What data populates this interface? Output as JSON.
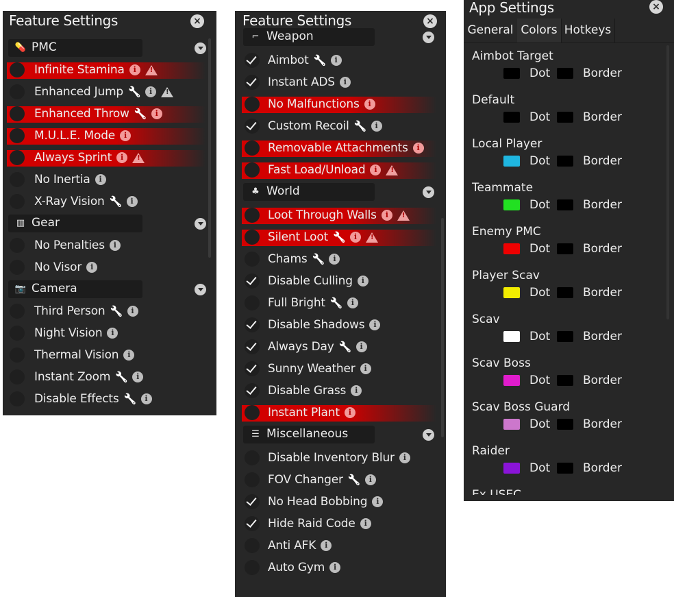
{
  "panel1": {
    "title": "Feature Settings",
    "close": "×",
    "sections": [
      {
        "name": "PMC",
        "icon": "pill-icon",
        "items": [
          {
            "label": "Infinite Stamina",
            "checked": false,
            "red": true,
            "wrench": false,
            "info": true,
            "warn": true
          },
          {
            "label": "Enhanced Jump",
            "checked": false,
            "red": false,
            "wrench": true,
            "info": true,
            "warn": true
          },
          {
            "label": "Enhanced Throw",
            "checked": false,
            "red": true,
            "wrench": true,
            "info": true,
            "warn": false
          },
          {
            "label": "M.U.L.E. Mode",
            "checked": false,
            "red": true,
            "wrench": false,
            "info": true,
            "warn": false
          },
          {
            "label": "Always Sprint",
            "checked": false,
            "red": true,
            "wrench": false,
            "info": true,
            "warn": true
          },
          {
            "label": "No Inertia",
            "checked": false,
            "red": false,
            "wrench": false,
            "info": true,
            "warn": false
          },
          {
            "label": "X-Ray Vision",
            "checked": false,
            "red": false,
            "wrench": true,
            "info": true,
            "warn": false
          }
        ]
      },
      {
        "name": "Gear",
        "icon": "gear-rack-icon",
        "items": [
          {
            "label": "No Penalties",
            "checked": false,
            "red": false,
            "wrench": false,
            "info": true,
            "warn": false
          },
          {
            "label": "No Visor",
            "checked": false,
            "red": false,
            "wrench": false,
            "info": true,
            "warn": false
          }
        ]
      },
      {
        "name": "Camera",
        "icon": "camera-icon",
        "items": [
          {
            "label": "Third Person",
            "checked": false,
            "red": false,
            "wrench": true,
            "info": true,
            "warn": false
          },
          {
            "label": "Night Vision",
            "checked": false,
            "red": false,
            "wrench": false,
            "info": true,
            "warn": false
          },
          {
            "label": "Thermal Vision",
            "checked": false,
            "red": false,
            "wrench": false,
            "info": true,
            "warn": false
          },
          {
            "label": "Instant Zoom",
            "checked": false,
            "red": false,
            "wrench": true,
            "info": true,
            "warn": false
          },
          {
            "label": "Disable Effects",
            "checked": false,
            "red": false,
            "wrench": true,
            "info": true,
            "warn": false
          }
        ]
      }
    ]
  },
  "panel2": {
    "title": "Feature Settings",
    "close": "×",
    "sections": [
      {
        "name": "Weapon",
        "icon": "pistol-icon",
        "items": [
          {
            "label": "Aimbot",
            "checked": true,
            "red": false,
            "wrench": true,
            "info": true,
            "warn": false
          },
          {
            "label": "Instant ADS",
            "checked": true,
            "red": false,
            "wrench": false,
            "info": true,
            "warn": false
          },
          {
            "label": "No Malfunctions",
            "checked": false,
            "red": true,
            "wrench": false,
            "info": true,
            "warn": false
          },
          {
            "label": "Custom Recoil",
            "checked": true,
            "red": false,
            "wrench": true,
            "info": true,
            "warn": false
          },
          {
            "label": "Removable Attachments",
            "checked": false,
            "red": true,
            "wrench": false,
            "info": true,
            "warn": false
          },
          {
            "label": "Fast Load/Unload",
            "checked": false,
            "red": true,
            "wrench": false,
            "info": true,
            "warn": true
          }
        ]
      },
      {
        "name": "World",
        "icon": "palm-tree-icon",
        "items": [
          {
            "label": "Loot Through Walls",
            "checked": false,
            "red": true,
            "wrench": false,
            "info": true,
            "warn": true
          },
          {
            "label": "Silent Loot",
            "checked": false,
            "red": true,
            "wrench": true,
            "info": true,
            "warn": true
          },
          {
            "label": "Chams",
            "checked": false,
            "red": false,
            "wrench": true,
            "info": true,
            "warn": false
          },
          {
            "label": "Disable Culling",
            "checked": true,
            "red": false,
            "wrench": false,
            "info": true,
            "warn": false
          },
          {
            "label": "Full Bright",
            "checked": false,
            "red": false,
            "wrench": true,
            "info": true,
            "warn": false
          },
          {
            "label": "Disable Shadows",
            "checked": true,
            "red": false,
            "wrench": false,
            "info": true,
            "warn": false
          },
          {
            "label": "Always Day",
            "checked": true,
            "red": false,
            "wrench": true,
            "info": true,
            "warn": false
          },
          {
            "label": "Sunny Weather",
            "checked": true,
            "red": false,
            "wrench": false,
            "info": true,
            "warn": false
          },
          {
            "label": "Disable Grass",
            "checked": true,
            "red": false,
            "wrench": false,
            "info": true,
            "warn": false
          },
          {
            "label": "Instant Plant",
            "checked": false,
            "red": true,
            "wrench": false,
            "info": true,
            "warn": false
          }
        ]
      },
      {
        "name": "Miscellaneous",
        "icon": "list-icon",
        "items": [
          {
            "label": "Disable Inventory Blur",
            "checked": false,
            "red": false,
            "wrench": false,
            "info": true,
            "warn": false
          },
          {
            "label": "FOV Changer",
            "checked": false,
            "red": false,
            "wrench": true,
            "info": true,
            "warn": false
          },
          {
            "label": "No Head Bobbing",
            "checked": true,
            "red": false,
            "wrench": false,
            "info": true,
            "warn": false
          },
          {
            "label": "Hide Raid Code",
            "checked": true,
            "red": false,
            "wrench": false,
            "info": true,
            "warn": false
          },
          {
            "label": "Anti AFK",
            "checked": false,
            "red": false,
            "wrench": false,
            "info": true,
            "warn": false
          },
          {
            "label": "Auto Gym",
            "checked": false,
            "red": false,
            "wrench": false,
            "info": true,
            "warn": false
          }
        ]
      }
    ]
  },
  "panel3": {
    "title": "App Settings",
    "close": "×",
    "tabs": [
      {
        "label": "General",
        "active": false
      },
      {
        "label": "Colors",
        "active": true
      },
      {
        "label": "Hotkeys",
        "active": false
      }
    ],
    "dot_label": "Dot",
    "border_label": "Border",
    "colors": [
      {
        "name": "Aimbot Target",
        "dot": "#000000",
        "border": "#000000"
      },
      {
        "name": "Default",
        "dot": "#000000",
        "border": "#000000"
      },
      {
        "name": "Local Player",
        "dot": "#1fb6e0",
        "border": "#000000"
      },
      {
        "name": "Teammate",
        "dot": "#22e022",
        "border": "#000000"
      },
      {
        "name": "Enemy PMC",
        "dot": "#ee0000",
        "border": "#000000"
      },
      {
        "name": "Player Scav",
        "dot": "#f2ec00",
        "border": "#000000"
      },
      {
        "name": "Scav",
        "dot": "#ffffff",
        "border": "#000000"
      },
      {
        "name": "Scav Boss",
        "dot": "#e01ccc",
        "border": "#000000"
      },
      {
        "name": "Scav Boss Guard",
        "dot": "#cc77cc",
        "border": "#000000"
      },
      {
        "name": "Raider",
        "dot": "#8a14d8",
        "border": "#000000"
      },
      {
        "name": "Ex USEC",
        "dot": "#000000",
        "border": "#000000"
      }
    ]
  }
}
